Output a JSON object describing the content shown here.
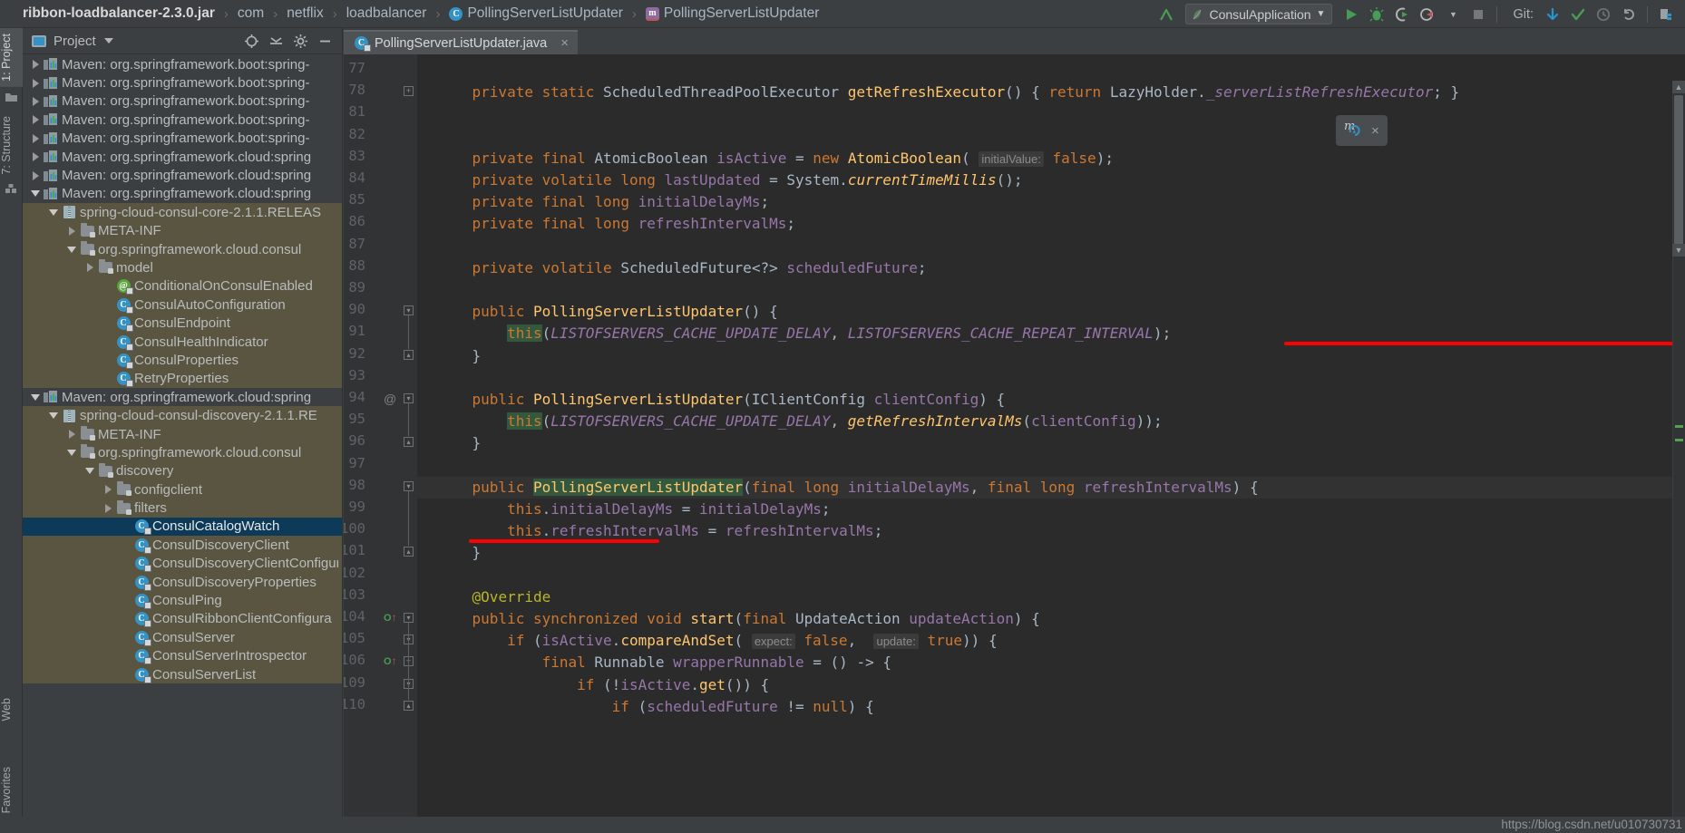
{
  "breadcrumb": [
    {
      "label": "ribbon-loadbalancer-2.3.0.jar",
      "icon": "none",
      "bold": true
    },
    {
      "label": "com",
      "icon": "none",
      "bold": false
    },
    {
      "label": "netflix",
      "icon": "none",
      "bold": false
    },
    {
      "label": "loadbalancer",
      "icon": "none",
      "bold": false
    },
    {
      "label": "PollingServerListUpdater",
      "icon": "class-icon",
      "bold": false
    },
    {
      "label": "PollingServerListUpdater",
      "icon": "method-icon",
      "bold": false
    }
  ],
  "toolbar": {
    "run_config": "ConsulApplication",
    "git_label": "Git:",
    "icons": [
      "build-icon",
      "run-icon",
      "debug-icon",
      "run-coverage-icon",
      "profile-icon",
      "stop-icon",
      "git-update-icon",
      "git-commit-icon",
      "git-history-icon",
      "git-rollback-icon",
      "git-diff-icon"
    ]
  },
  "left_stripe": {
    "top": [
      {
        "label": "1: Project",
        "active": true
      },
      {
        "label": "7: Structure",
        "active": false
      }
    ],
    "bottom": [
      {
        "label": "2: Favorites",
        "active": false
      },
      {
        "label": "Web",
        "active": false
      }
    ]
  },
  "project_panel": {
    "title": "Project",
    "actions": [
      "locate-icon",
      "collapse-all-icon",
      "gear-icon",
      "hide-icon"
    ],
    "tree": [
      {
        "depth": 0,
        "arrow": "right",
        "icon": "maven-icon",
        "label": "Maven: org.springframework.boot:spring-",
        "state": "normal"
      },
      {
        "depth": 0,
        "arrow": "right",
        "icon": "maven-icon",
        "label": "Maven: org.springframework.boot:spring-",
        "state": "normal"
      },
      {
        "depth": 0,
        "arrow": "right",
        "icon": "maven-icon",
        "label": "Maven: org.springframework.boot:spring-",
        "state": "normal"
      },
      {
        "depth": 0,
        "arrow": "right",
        "icon": "maven-icon",
        "label": "Maven: org.springframework.boot:spring-",
        "state": "normal"
      },
      {
        "depth": 0,
        "arrow": "right",
        "icon": "maven-icon",
        "label": "Maven: org.springframework.boot:spring-",
        "state": "normal"
      },
      {
        "depth": 0,
        "arrow": "right",
        "icon": "maven-icon",
        "label": "Maven: org.springframework.cloud:spring",
        "state": "normal"
      },
      {
        "depth": 0,
        "arrow": "right",
        "icon": "maven-icon",
        "label": "Maven: org.springframework.cloud:spring",
        "state": "normal"
      },
      {
        "depth": 0,
        "arrow": "down",
        "icon": "maven-icon",
        "label": "Maven: org.springframework.cloud:spring",
        "state": "normal"
      },
      {
        "depth": 1,
        "arrow": "down",
        "icon": "jar-icon",
        "label": "spring-cloud-consul-core-2.1.1.RELEAS",
        "state": "shaded"
      },
      {
        "depth": 2,
        "arrow": "right",
        "icon": "folder-icon",
        "label": "META-INF",
        "state": "shaded"
      },
      {
        "depth": 2,
        "arrow": "down",
        "icon": "folder-icon",
        "label": "org.springframework.cloud.consul",
        "state": "shaded"
      },
      {
        "depth": 3,
        "arrow": "right",
        "icon": "folder-icon",
        "label": "model",
        "state": "shaded"
      },
      {
        "depth": 4,
        "arrow": "none",
        "icon": "annotation-icon",
        "label": "ConditionalOnConsulEnabled",
        "state": "shaded"
      },
      {
        "depth": 4,
        "arrow": "none",
        "icon": "class-icon",
        "label": "ConsulAutoConfiguration",
        "state": "shaded"
      },
      {
        "depth": 4,
        "arrow": "none",
        "icon": "class-icon",
        "label": "ConsulEndpoint",
        "state": "shaded"
      },
      {
        "depth": 4,
        "arrow": "none",
        "icon": "class-icon",
        "label": "ConsulHealthIndicator",
        "state": "shaded"
      },
      {
        "depth": 4,
        "arrow": "none",
        "icon": "class-icon",
        "label": "ConsulProperties",
        "state": "shaded"
      },
      {
        "depth": 4,
        "arrow": "none",
        "icon": "class-icon",
        "label": "RetryProperties",
        "state": "shaded"
      },
      {
        "depth": 0,
        "arrow": "down",
        "icon": "maven-icon",
        "label": "Maven: org.springframework.cloud:spring",
        "state": "normal"
      },
      {
        "depth": 1,
        "arrow": "down",
        "icon": "jar-icon",
        "label": "spring-cloud-consul-discovery-2.1.1.RE",
        "state": "shaded"
      },
      {
        "depth": 2,
        "arrow": "right",
        "icon": "folder-icon",
        "label": "META-INF",
        "state": "shaded"
      },
      {
        "depth": 2,
        "arrow": "down",
        "icon": "folder-icon",
        "label": "org.springframework.cloud.consul",
        "state": "shaded"
      },
      {
        "depth": 3,
        "arrow": "down",
        "icon": "folder-icon",
        "label": "discovery",
        "state": "shaded"
      },
      {
        "depth": 4,
        "arrow": "right",
        "icon": "folder-icon",
        "label": "configclient",
        "state": "shaded"
      },
      {
        "depth": 4,
        "arrow": "right",
        "icon": "folder-icon",
        "label": "filters",
        "state": "shaded"
      },
      {
        "depth": 5,
        "arrow": "none",
        "icon": "class-icon",
        "label": "ConsulCatalogWatch",
        "state": "selected"
      },
      {
        "depth": 5,
        "arrow": "none",
        "icon": "class-icon",
        "label": "ConsulDiscoveryClient",
        "state": "shaded"
      },
      {
        "depth": 5,
        "arrow": "none",
        "icon": "class-icon",
        "label": "ConsulDiscoveryClientConfigura",
        "state": "shaded"
      },
      {
        "depth": 5,
        "arrow": "none",
        "icon": "class-icon",
        "label": "ConsulDiscoveryProperties",
        "state": "shaded"
      },
      {
        "depth": 5,
        "arrow": "none",
        "icon": "class-icon",
        "label": "ConsulPing",
        "state": "shaded"
      },
      {
        "depth": 5,
        "arrow": "none",
        "icon": "class-icon",
        "label": "ConsulRibbonClientConfigura",
        "state": "shaded"
      },
      {
        "depth": 5,
        "arrow": "none",
        "icon": "class-icon",
        "label": "ConsulServer",
        "state": "shaded"
      },
      {
        "depth": 5,
        "arrow": "none",
        "icon": "class-icon",
        "label": "ConsulServerIntrospector",
        "state": "shaded"
      },
      {
        "depth": 5,
        "arrow": "none",
        "icon": "class-icon",
        "label": "ConsulServerList",
        "state": "shaded"
      }
    ]
  },
  "editor": {
    "tab": {
      "label": "PollingServerListUpdater.java",
      "icon": "class-icon",
      "close": "×"
    },
    "first_line_number": 77,
    "current_line": 98,
    "line_numbers": [
      77,
      78,
      81,
      82,
      83,
      84,
      85,
      86,
      87,
      88,
      89,
      90,
      91,
      92,
      93,
      94,
      95,
      96,
      97,
      98,
      99,
      100,
      101,
      102,
      103,
      104,
      105,
      106,
      109,
      110
    ],
    "gutter_marks": [
      {
        "line": 94,
        "glyph": "@"
      },
      {
        "line": 104,
        "glyph": "O↑"
      },
      {
        "line": 106,
        "glyph": "O↑"
      }
    ],
    "code_lines": [
      {
        "n": 77,
        "text": ""
      },
      {
        "n": 78,
        "text": "    private static ScheduledThreadPoolExecutor getRefreshExecutor() { return LazyHolder._serverListRefreshExecutor; }"
      },
      {
        "n": 81,
        "text": ""
      },
      {
        "n": 82,
        "text": ""
      },
      {
        "n": 83,
        "text": "    private final AtomicBoolean isActive = new AtomicBoolean( initialValue: false);"
      },
      {
        "n": 84,
        "text": "    private volatile long lastUpdated = System.currentTimeMillis();"
      },
      {
        "n": 85,
        "text": "    private final long initialDelayMs;"
      },
      {
        "n": 86,
        "text": "    private final long refreshIntervalMs;"
      },
      {
        "n": 87,
        "text": ""
      },
      {
        "n": 88,
        "text": "    private volatile ScheduledFuture<?> scheduledFuture;"
      },
      {
        "n": 89,
        "text": ""
      },
      {
        "n": 90,
        "text": "    public PollingServerListUpdater() {"
      },
      {
        "n": 91,
        "text": "        this(LISTOFSERVERS_CACHE_UPDATE_DELAY, LISTOFSERVERS_CACHE_REPEAT_INTERVAL);"
      },
      {
        "n": 92,
        "text": "    }"
      },
      {
        "n": 93,
        "text": ""
      },
      {
        "n": 94,
        "text": "    public PollingServerListUpdater(IClientConfig clientConfig) {"
      },
      {
        "n": 95,
        "text": "        this(LISTOFSERVERS_CACHE_UPDATE_DELAY, getRefreshIntervalMs(clientConfig));"
      },
      {
        "n": 96,
        "text": "    }"
      },
      {
        "n": 97,
        "text": ""
      },
      {
        "n": 98,
        "text": "    public PollingServerListUpdater(final long initialDelayMs, final long refreshIntervalMs) {"
      },
      {
        "n": 99,
        "text": "        this.initialDelayMs = initialDelayMs;"
      },
      {
        "n": 100,
        "text": "        this.refreshIntervalMs = refreshIntervalMs;"
      },
      {
        "n": 101,
        "text": "    }"
      },
      {
        "n": 102,
        "text": ""
      },
      {
        "n": 103,
        "text": "    @Override"
      },
      {
        "n": 104,
        "text": "    public synchronized void start(final UpdateAction updateAction) {"
      },
      {
        "n": 105,
        "text": "        if (isActive.compareAndSet( expect: false,  update: true)) {"
      },
      {
        "n": 106,
        "text": "            final Runnable wrapperRunnable = () -> {"
      },
      {
        "n": 109,
        "text": "                if (!isActive.get()) {"
      },
      {
        "n": 110,
        "text": "                    if (scheduledFuture != null) {"
      }
    ],
    "annotations": [
      {
        "name": "red-underline-1",
        "target_line": 91,
        "note": "LISTOFSERVERS_CACHE_REPEAT_INTERVAL"
      },
      {
        "name": "red-underline-2",
        "target_line": 100,
        "note": "refreshIntervalMs"
      }
    ],
    "inline_hints": [
      "initialValue:",
      "expect:",
      "update:"
    ],
    "floating_widget": {
      "icon": "maven-reload-icon",
      "close": "×"
    }
  },
  "status": {
    "watermark": "https://blog.csdn.net/u010730731"
  },
  "colors": {
    "accent_blue": "#3592c4",
    "selection": "#0d3a58",
    "shaded_row": "#5a5540",
    "editor_bg": "#2b2b2b",
    "gutter_bg": "#313335",
    "panel_bg": "#3c3f41",
    "underline_red": "#fe0000",
    "keyword": "#cc7832",
    "method": "#ffc66d",
    "field": "#9876aa",
    "annotation": "#bbb529",
    "number": "#6897bb",
    "text": "#a9b7c6"
  }
}
